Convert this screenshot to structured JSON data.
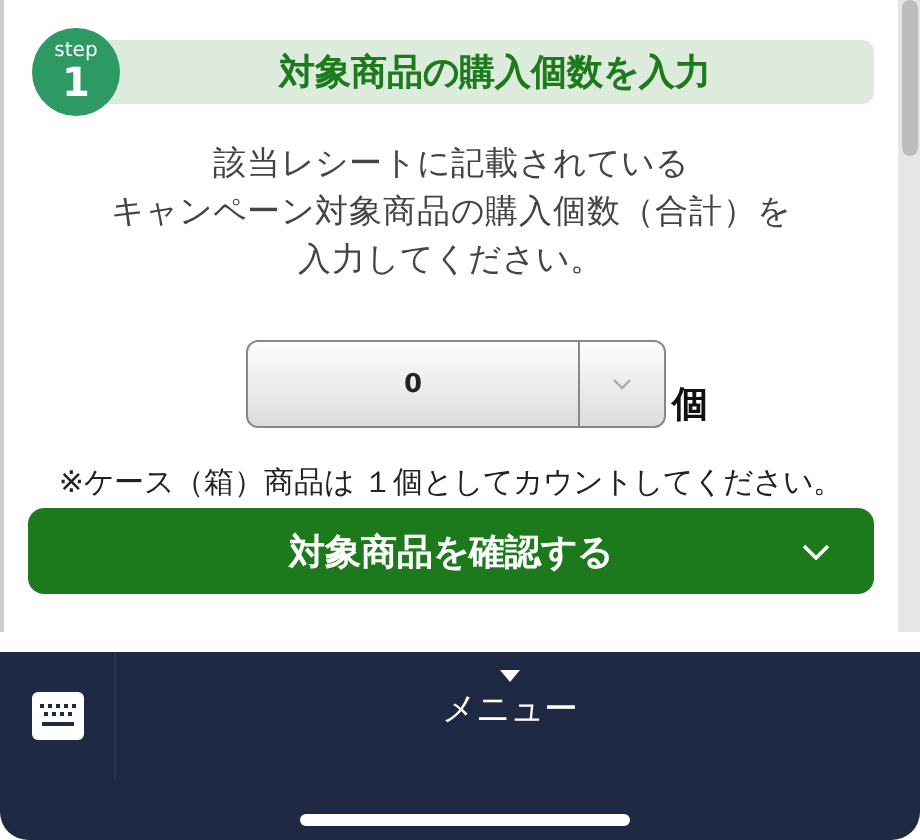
{
  "step": {
    "label": "step",
    "number": "1",
    "title": "対象商品の購入個数を入力"
  },
  "instructions": [
    "該当レシートに記載されている",
    "キャンペーン対象商品の購入個数（合計）を",
    "入力してください。"
  ],
  "quantity": {
    "value": "0",
    "unit": "個"
  },
  "note": "※ケース（箱）商品は １個としてカウントしてください。",
  "confirm_button": {
    "label": "対象商品を確認する",
    "expanded": false
  },
  "bottom_bar": {
    "menu_label": "メニュー"
  }
}
